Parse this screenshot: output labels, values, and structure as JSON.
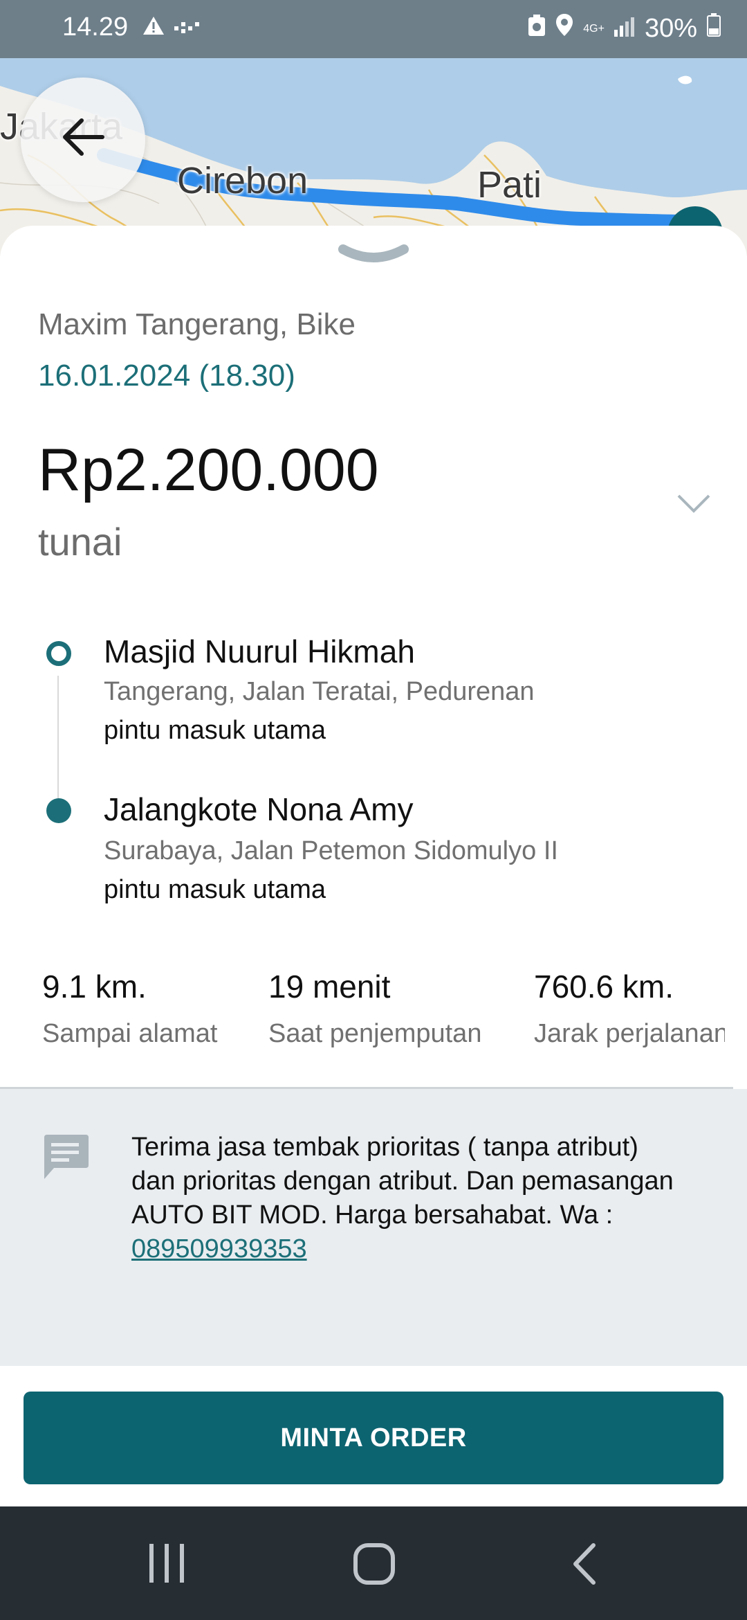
{
  "status_bar": {
    "time": "14.29",
    "network": "4G+",
    "battery": "30%"
  },
  "map": {
    "cities": [
      "Jakarta",
      "Cirebon",
      "Pati"
    ]
  },
  "order": {
    "service": "Maxim Tangerang, Bike",
    "datetime": "16.01.2024 (18.30)",
    "price": "Rp2.200.000",
    "payment_method": "tunai"
  },
  "route": {
    "pickup": {
      "title": "Masjid Nuurul Hikmah",
      "address": "Tangerang, Jalan Teratai, Pedurenan",
      "note": "pintu masuk utama"
    },
    "dropoff": {
      "title": "Jalangkote Nona Amy",
      "address": "Surabaya, Jalan Petemon Sidomulyo II",
      "note": "pintu masuk utama"
    }
  },
  "stats": [
    {
      "value": "9.1 km.",
      "label": "Sampai alamat"
    },
    {
      "value": "19 menit",
      "label": "Saat penjemputan"
    },
    {
      "value": "760.6 km.",
      "label": "Jarak perjalanan"
    }
  ],
  "comment": {
    "text": "Terima jasa tembak prioritas ( tanpa atribut) dan prioritas dengan atribut. Dan pemasangan AUTO BIT MOD. Harga bersahabat. Wa :",
    "phone": " 089509939353"
  },
  "action": {
    "button_label": "MINTA ORDER"
  },
  "colors": {
    "accent": "#0d6471",
    "route": "#2f8bea",
    "sea": "#aecde8"
  }
}
